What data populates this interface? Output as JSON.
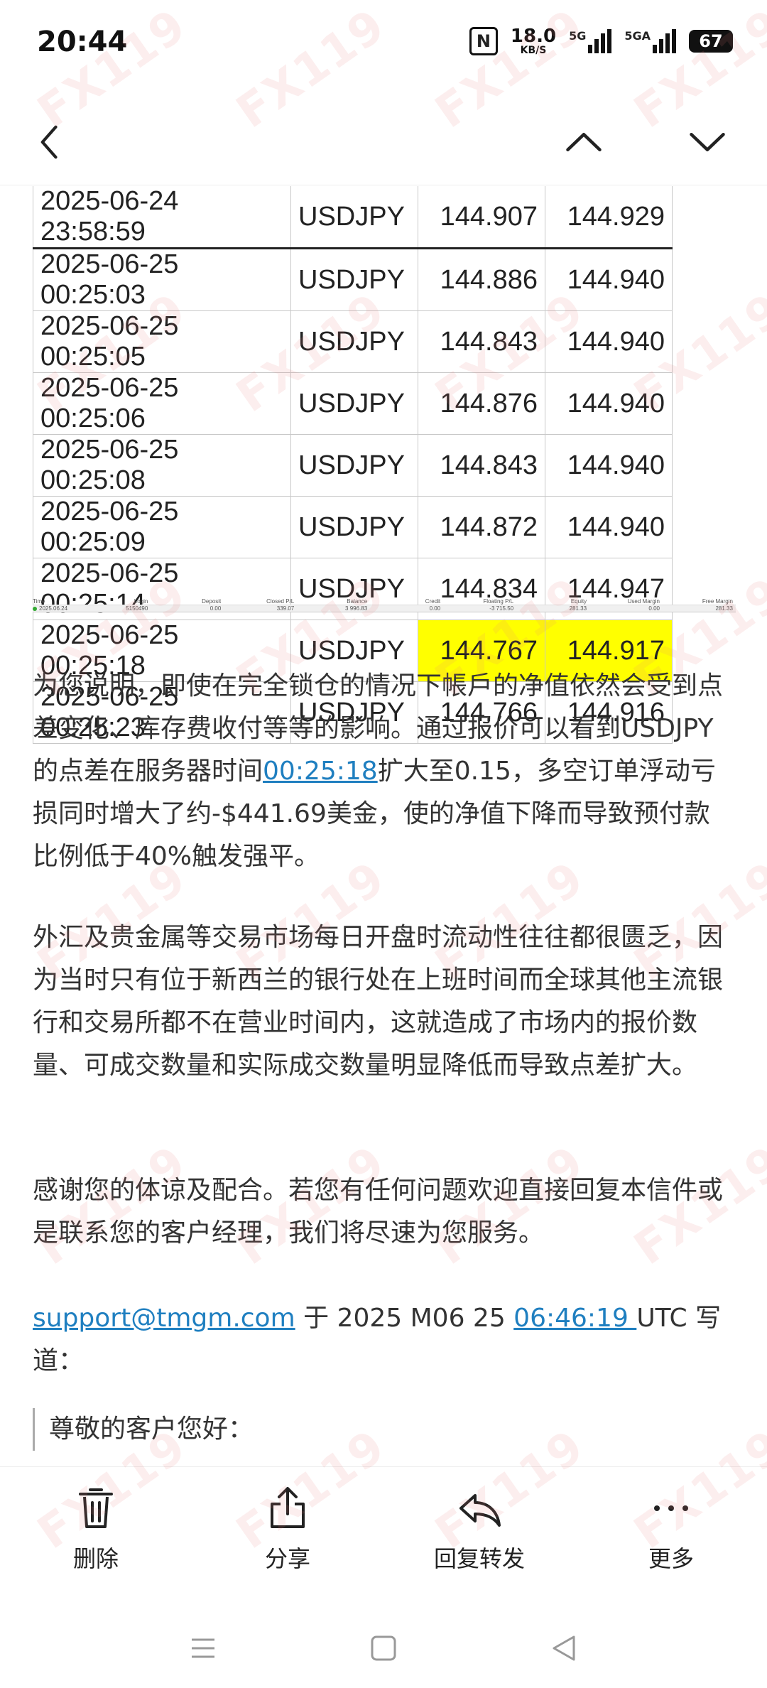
{
  "status": {
    "time": "20:44",
    "net_speed_value": "18.0",
    "net_speed_unit": "KB/S",
    "sim1_label": "5G",
    "sim2_label": "5GA",
    "battery": "67"
  },
  "quote_table": [
    {
      "datetime": "2025-06-24 23:58:59",
      "symbol": "USDJPY",
      "bid": "144.907",
      "ask": "144.929"
    },
    {
      "datetime": "2025-06-25 00:25:03",
      "symbol": "USDJPY",
      "bid": "144.886",
      "ask": "144.940"
    },
    {
      "datetime": "2025-06-25 00:25:05",
      "symbol": "USDJPY",
      "bid": "144.843",
      "ask": "144.940"
    },
    {
      "datetime": "2025-06-25 00:25:06",
      "symbol": "USDJPY",
      "bid": "144.876",
      "ask": "144.940"
    },
    {
      "datetime": "2025-06-25 00:25:08",
      "symbol": "USDJPY",
      "bid": "144.843",
      "ask": "144.940"
    },
    {
      "datetime": "2025-06-25 00:25:09",
      "symbol": "USDJPY",
      "bid": "144.872",
      "ask": "144.940"
    },
    {
      "datetime": "2025-06-25 00:25:14",
      "symbol": "USDJPY",
      "bid": "144.834",
      "ask": "144.947"
    },
    {
      "datetime": "2025-06-25 00:25:18",
      "symbol": "USDJPY",
      "bid": "144.767",
      "ask": "144.917"
    },
    {
      "datetime": "2025-06-25 00:25:23",
      "symbol": "USDJPY",
      "bid": "144.766",
      "ask": "144.916"
    }
  ],
  "highlight_color": "#ffff00",
  "account_table": {
    "headers": [
      "Time",
      "Login",
      "Deposit",
      "Closed P/L",
      "Balance",
      "Credit",
      "Floating P/L",
      "Equity",
      "Used Margin",
      "Free Margin"
    ],
    "row": [
      "2025.06.24",
      "5150490",
      "0.00",
      "339.07",
      "3 996.83",
      "0.00",
      "-3 715.50",
      "281.33",
      "0.00",
      "281.33"
    ]
  },
  "para1": {
    "a": "为您说明，即使在完全锁仓的情况下帳戶的净值依然会受到点差变化、库存费收付等等的影响。通过报价可以看到USDJPY的点差在服务器时间",
    "link": "00:25:18",
    "b": "扩大至0.15，多空订单浮动亏损同时增大了约-$441.69美金，使的净值下降而导致预付款比例低于40%触发强平。"
  },
  "para2": "外汇及贵金属等交易市场每日开盘时流动性往往都很匮乏，因为当时只有位于新西兰的银行处在上班时间而全球其他主流银行和交易所都不在营业时间内，这就造成了市场内的报价数量、可成交数量和实际成交数量明显降低而导致点差扩大。",
  "para3": "感谢您的体谅及配合。若您有任何问题欢迎直接回复本信件或是联系您的客户经理，我们将尽速为您服务。",
  "reply_header": {
    "email": "support@tmgm.com",
    "mid": " 于 2025 M06 25 ",
    "time": "06:46:19 ",
    "end": "UTC 写道："
  },
  "quoted_text": "尊敬的客户您好：",
  "toolbar": {
    "delete": "删除",
    "share": "分享",
    "reply_forward": "回复转发",
    "more": "更多"
  },
  "watermark": "FX119",
  "link_color": "#1f7fc0"
}
